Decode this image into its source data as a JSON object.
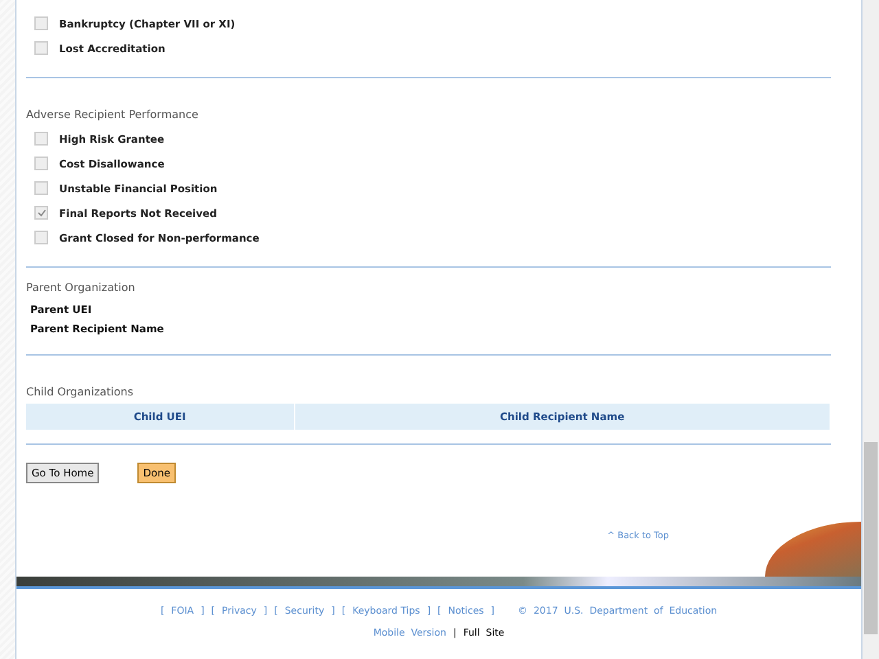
{
  "sections": [
    {
      "items": [
        {
          "label": "Bankruptcy (Chapter VII or XI)",
          "checked": false
        },
        {
          "label": "Lost Accreditation",
          "checked": false
        }
      ]
    },
    {
      "title": "Adverse Recipient Performance",
      "items": [
        {
          "label": "High Risk Grantee",
          "checked": false
        },
        {
          "label": "Cost Disallowance",
          "checked": false
        },
        {
          "label": "Unstable Financial Position",
          "checked": false
        },
        {
          "label": "Final Reports Not Received",
          "checked": true
        },
        {
          "label": "Grant Closed for Non-performance",
          "checked": false
        }
      ]
    }
  ],
  "parent": {
    "title": "Parent Organization",
    "fields": [
      "Parent UEI",
      "Parent Recipient Name"
    ]
  },
  "child": {
    "title": "Child Organizations",
    "columns": [
      "Child UEI",
      "Child Recipient Name"
    ]
  },
  "buttons": [
    {
      "label": "Go To Home",
      "kind": "default"
    },
    {
      "label": "Done",
      "kind": "primary"
    }
  ],
  "back_to_top": "^ Back to Top",
  "footer": {
    "links": [
      {
        "open": "[",
        "label": "FOIA",
        "close": "]"
      },
      {
        "open": "[",
        "label": "Privacy",
        "close": "]"
      },
      {
        "open": "[",
        "label": "Security",
        "close": "]"
      },
      {
        "open": "[",
        "label": "Keyboard Tips",
        "close": "]"
      },
      {
        "open": "[",
        "label": "Notices",
        "close": "]"
      }
    ],
    "copyright": "©  2017  U.S.  Department  of  Education",
    "mobile": "Mobile  Version",
    "separator": "|",
    "full": "Full  Site"
  }
}
